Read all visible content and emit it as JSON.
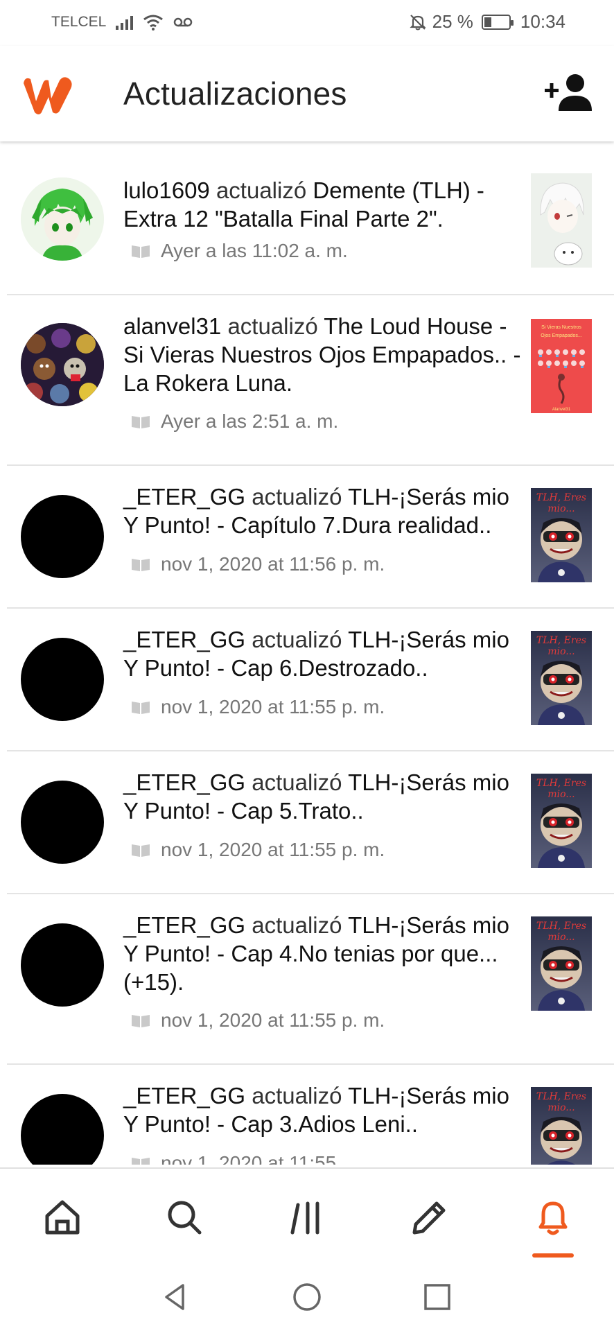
{
  "status_bar": {
    "carrier": "TELCEL",
    "battery_pct": "25 %",
    "battery_level": 0.25,
    "time": "10:34",
    "icons": [
      "signal-icon",
      "wifi-icon",
      "voicemail-icon",
      "mute-icon",
      "battery-icon"
    ]
  },
  "header": {
    "title": "Actualizaciones",
    "logo": "wattpad-logo",
    "action_icon": "add-user-icon",
    "brand_color": "#ef5a1e"
  },
  "feed": {
    "items": [
      {
        "user": "lulo1609",
        "verb": "actualizó",
        "story": "Demente (TLH) - Extra 12 \"Batalla Final Parte 2\".",
        "time": "Ayer a las 11:02 a. m.",
        "avatar": "anime-green-avatar",
        "cover": "anime-white-cover"
      },
      {
        "user": "alanvel31",
        "verb": "actualizó",
        "story": "The Loud House - Si Vieras Nuestros Ojos Empapados.. - La Rokera Luna.",
        "time": "Ayer a las 2:51 a. m.",
        "avatar": "fnaf-avatar",
        "cover": "red-cover",
        "cover_text": "Si Vieras Nuestros Ojos Empapados...",
        "cover_author": "Alanvel31"
      },
      {
        "user": "_ETER_GG",
        "verb": "actualizó",
        "story": "TLH-¡Serás mio Y Punto! - Capítulo 7.Dura realidad..",
        "time": "nov 1, 2020 at 11:56 p. m.",
        "avatar": "black-avatar",
        "cover": "dark-character-cover",
        "cover_text": "TLH, Eres mio..."
      },
      {
        "user": "_ETER_GG",
        "verb": "actualizó",
        "story": "TLH-¡Serás mio Y Punto! - Cap 6.Destrozado..",
        "time": "nov 1, 2020 at 11:55 p. m.",
        "avatar": "black-avatar",
        "cover": "dark-character-cover",
        "cover_text": "TLH, Eres mio..."
      },
      {
        "user": "_ETER_GG",
        "verb": "actualizó",
        "story": "TLH-¡Serás mio Y Punto! - Cap 5.Trato..",
        "time": "nov 1, 2020 at 11:55 p. m.",
        "avatar": "black-avatar",
        "cover": "dark-character-cover",
        "cover_text": "TLH, Eres mio..."
      },
      {
        "user": "_ETER_GG",
        "verb": "actualizó",
        "story": "TLH-¡Serás mio Y Punto! - Cap 4.No tenias por que...(+15).",
        "time": "nov 1, 2020 at 11:55 p. m.",
        "avatar": "black-avatar",
        "cover": "dark-character-cover",
        "cover_text": "TLH, Eres mio..."
      },
      {
        "user": "_ETER_GG",
        "verb": "actualizó",
        "story": "TLH-¡Serás mio Y Punto! - Cap 3.Adios Leni..",
        "time": "nov 1, 2020 at 11:55",
        "avatar": "black-avatar",
        "cover": "dark-character-cover",
        "cover_text": "TLH, Eres mio..."
      }
    ]
  },
  "bottom_nav": {
    "items": [
      "home-icon",
      "search-icon",
      "library-icon",
      "write-icon",
      "notifications-icon"
    ],
    "active": "notifications-icon",
    "active_color": "#ef5a1e"
  },
  "system_nav": {
    "items": [
      "back-icon",
      "home-circle-icon",
      "recents-icon"
    ]
  }
}
